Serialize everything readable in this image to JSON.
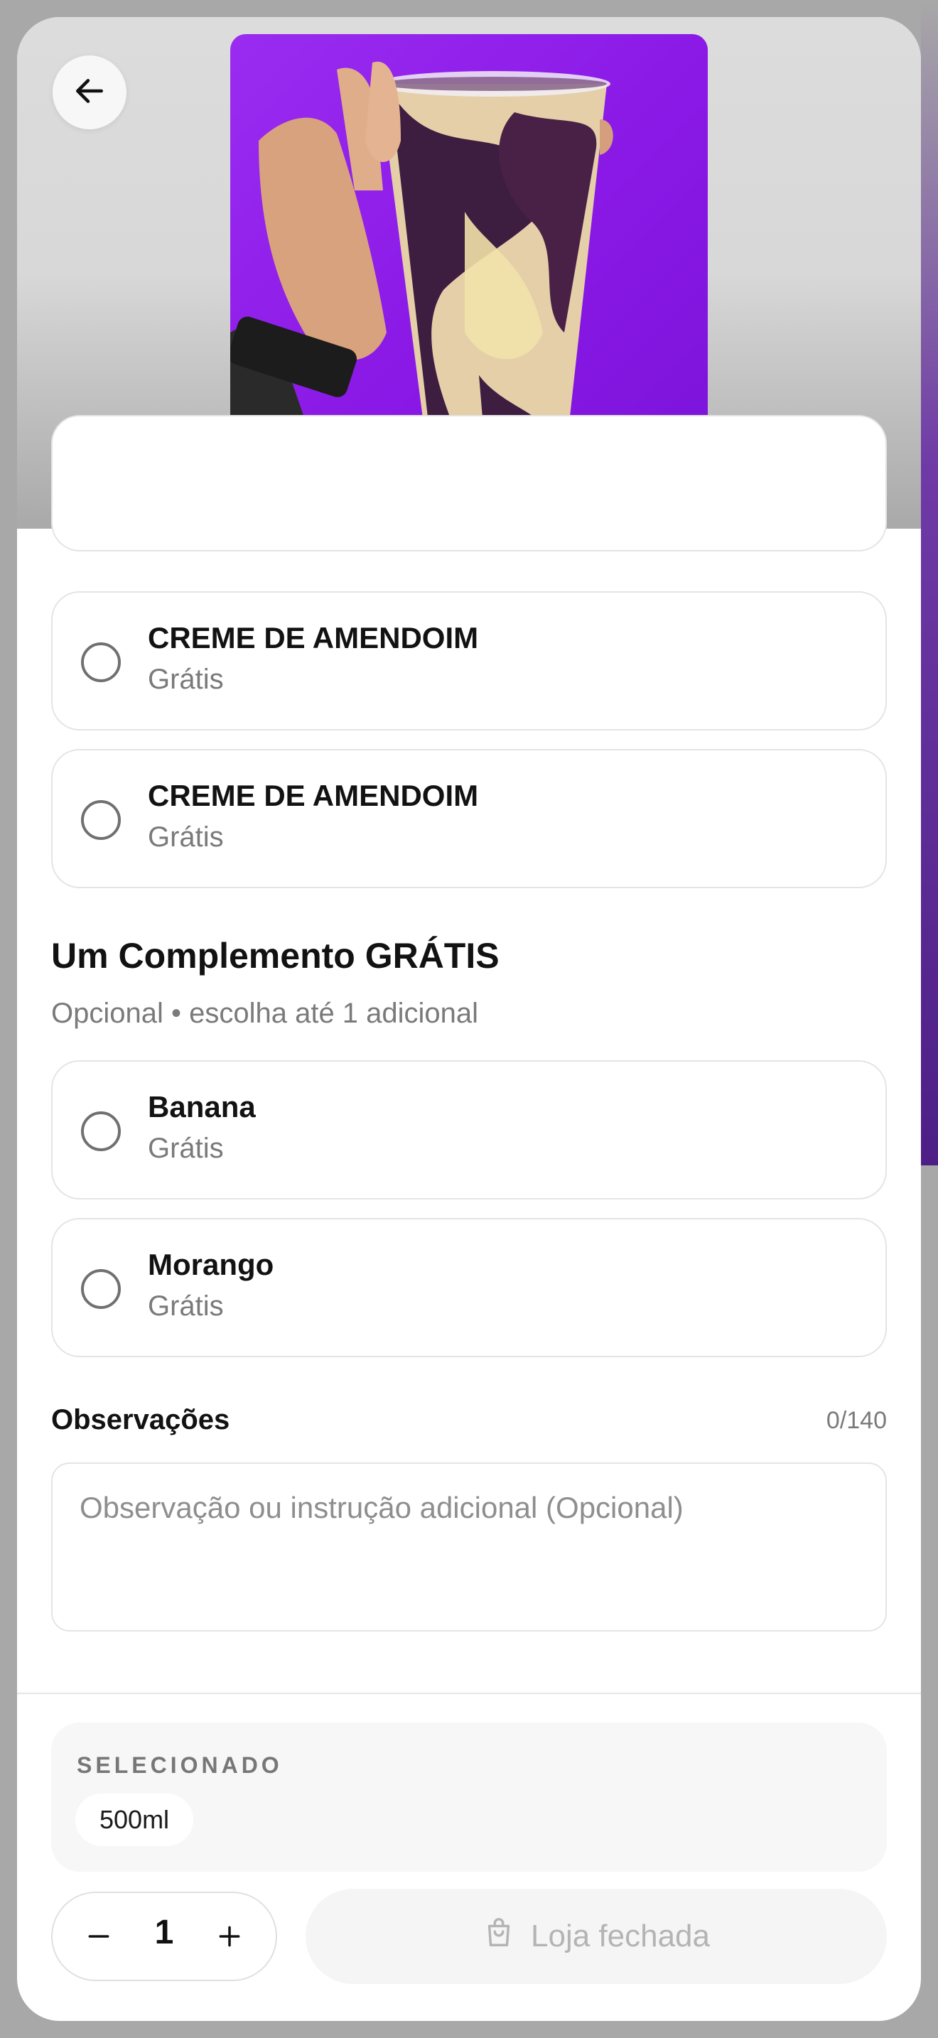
{
  "nav": {
    "back_icon": "arrow-left-icon"
  },
  "product": {
    "image_alt": "Copo de açaí com creme de amendoim"
  },
  "options_prev": [
    {
      "name": "CREME DE AMENDOIM",
      "price": "Grátis"
    },
    {
      "name": "CREME DE AMENDOIM",
      "price": "Grátis"
    }
  ],
  "complement": {
    "title": "Um Complemento GRÁTIS",
    "subtitle": "Opcional • escolha até 1 adicional",
    "items": [
      {
        "name": "Banana",
        "price": "Grátis"
      },
      {
        "name": "Morango",
        "price": "Grátis"
      }
    ]
  },
  "observations": {
    "label": "Observações",
    "counter": "0/140",
    "placeholder": "Observação ou instrução adicional (Opcional)"
  },
  "selected": {
    "label": "SELECIONADO",
    "chip": "500ml"
  },
  "quantity": {
    "value": "1"
  },
  "cta": {
    "label": "Loja fechada",
    "icon": "shopping-bag-icon"
  },
  "colors": {
    "hero_purple": "#8a18e6",
    "border": "#e4e4e4",
    "muted_text": "#7a7a7a"
  }
}
